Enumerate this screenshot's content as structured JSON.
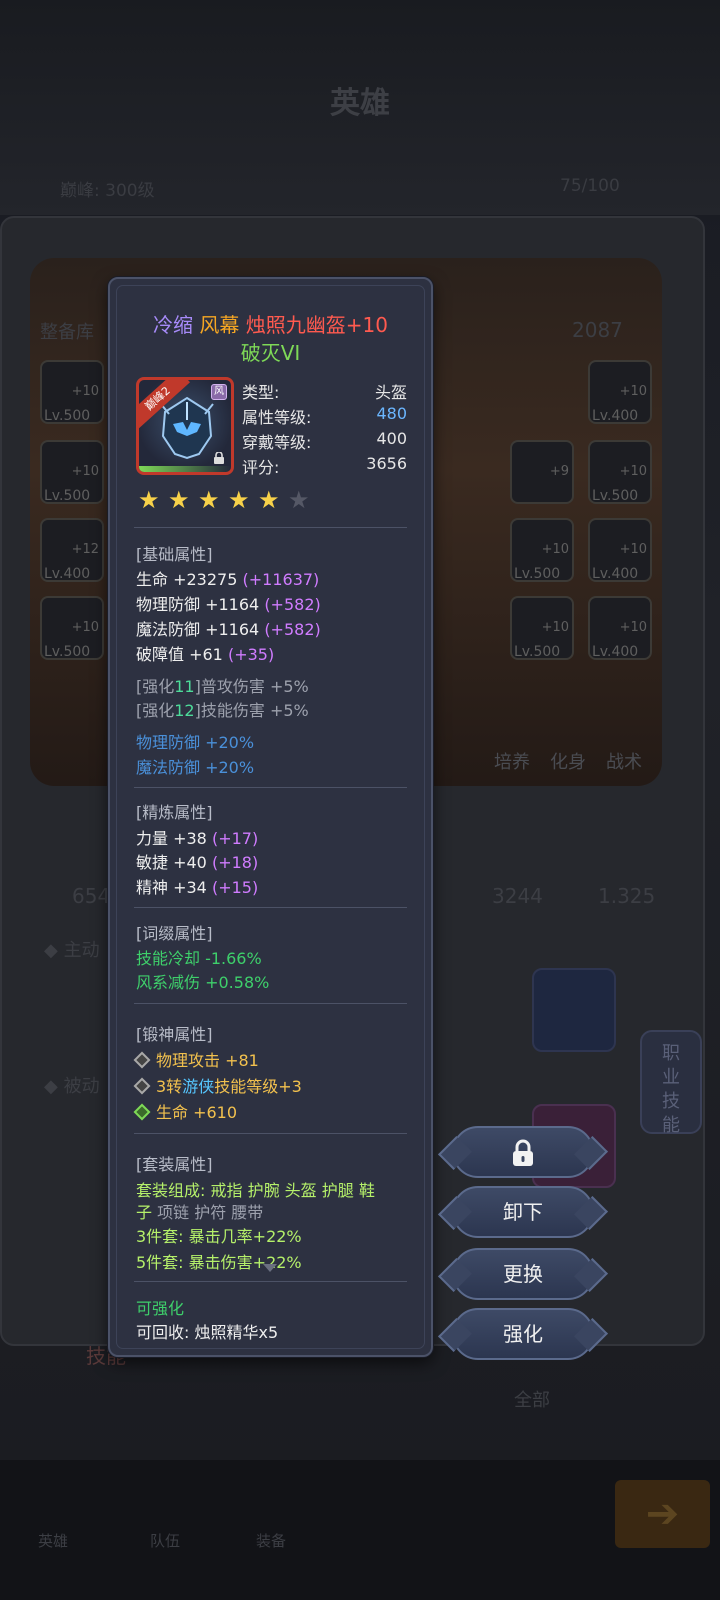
{
  "background": {
    "screen_title": "英雄",
    "level_text": "巅峰: 300级",
    "count_text": "75/100",
    "equip_lib": "整备库",
    "power_value": "2087",
    "stat_left": "654",
    "stat_mid": "3244",
    "stat_right": "1.325",
    "active_label": "◆ 主动",
    "passive_label": "◆ 被动",
    "side_tab": "职业技能",
    "filter_all": "全部",
    "skill_tab": "技能",
    "tabs_right": [
      "培养",
      "化身",
      "战术"
    ],
    "slots_left": [
      {
        "lv": "Lv.500",
        "plus": "+10"
      },
      {
        "lv": "Lv.500",
        "plus": "+10"
      },
      {
        "lv": "Lv.400",
        "plus": "+12"
      },
      {
        "lv": "Lv.500",
        "plus": "+10"
      }
    ],
    "slots_right": [
      {
        "lv": "Lv.400",
        "plus": "+10"
      },
      {
        "lv": "Lv.500",
        "plus": "+10"
      },
      {
        "lv": "Lv.400",
        "plus": "+10"
      },
      {
        "lv": "Lv.400",
        "plus": "+10"
      }
    ],
    "slots_mid": [
      {
        "lv": "",
        "plus": "+9"
      },
      {
        "lv": "Lv.500",
        "plus": "+10"
      },
      {
        "lv": "Lv.500",
        "plus": "+10"
      }
    ],
    "nav": [
      "英雄",
      "队伍",
      "装备"
    ]
  },
  "item": {
    "title_parts": [
      "冷缩",
      "风幕",
      "烛照九幽盔+10"
    ],
    "subtitle": "破灭VI",
    "ribbon": "巅峰2",
    "badge": "风",
    "type_label": "类型:",
    "type_value": "头盔",
    "attr_level_label": "属性等级:",
    "attr_level_value": "480",
    "wear_level_label": "穿戴等级:",
    "wear_level_value": "400",
    "score_label": "评分:",
    "score_value": "3656",
    "stars": 5,
    "stars_max": 6
  },
  "sections": {
    "basic_title": "[基础属性]",
    "basic": [
      {
        "name": "生命 +23275",
        "bonus": "(+11637)"
      },
      {
        "name": "物理防御 +1164",
        "bonus": "(+582)"
      },
      {
        "name": "魔法防御 +1164",
        "bonus": "(+582)"
      },
      {
        "name": "破障值 +61",
        "bonus": "(+35)"
      }
    ],
    "enhance": [
      {
        "pre": "[强化",
        "num": "11",
        "post": "]普攻伤害 +5%"
      },
      {
        "pre": "[强化",
        "num": "12",
        "post": "]技能伤害 +5%"
      }
    ],
    "extra": [
      "物理防御 +20%",
      "魔法防御 +20%"
    ],
    "refine_title": "[精炼属性]",
    "refine": [
      {
        "name": "力量 +38",
        "bonus": "(+17)"
      },
      {
        "name": "敏捷 +40",
        "bonus": "(+18)"
      },
      {
        "name": "精神 +34",
        "bonus": "(+15)"
      }
    ],
    "affix_title": "[词缀属性]",
    "affix": [
      "技能冷却 -1.66%",
      "风系减伤 +0.58%"
    ],
    "forge_title": "[锻神属性]",
    "forge": [
      {
        "a": "物理攻击 +81",
        "b": "",
        "c": ""
      },
      {
        "a": "3转",
        "b": "游侠",
        "c": "技能等级+3"
      },
      {
        "a": "生命 +610",
        "b": "",
        "c": ""
      }
    ],
    "set_title": "[套装属性]",
    "set_line1_label": "套装组成: ",
    "set_line1_active": "戒指 护腕 头盔 护腿 鞋",
    "set_line2_active": "子",
    "set_line2_inactive": " 项链 护符 腰带",
    "set3": "3件套: 暴击几率+22%",
    "set5": "5件套: 暴击伤害+22%",
    "can_enhance": "可强化",
    "recycle": "可回收: 烛照精华x5"
  },
  "actions": {
    "unequip": "卸下",
    "replace": "更换",
    "enhance": "强化"
  }
}
